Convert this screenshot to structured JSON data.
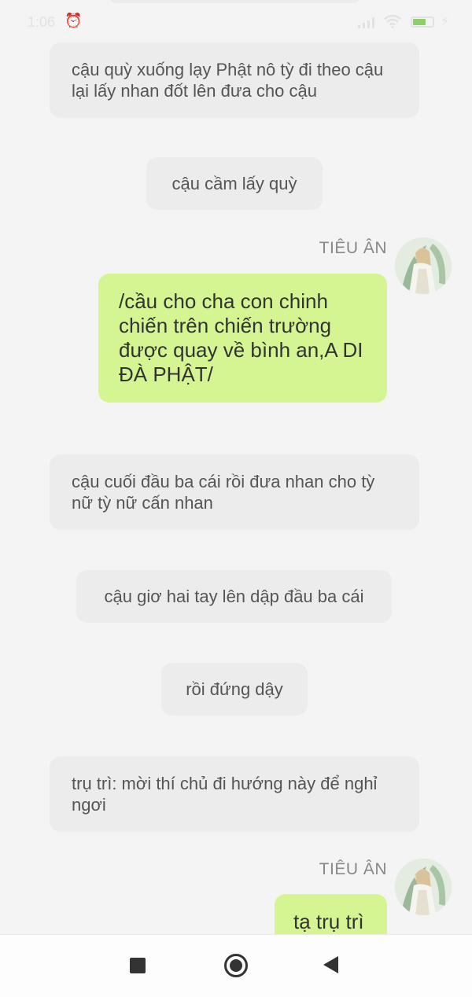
{
  "status_bar": {
    "time": "1:06",
    "battery": "65",
    "battery_percent": 65
  },
  "messages": [
    {
      "type": "narration",
      "text": "cậu quỳ xuống lạy Phật nô tỳ đi theo cậu lại lấy nhan đốt lên đưa cho cậu"
    },
    {
      "type": "narration",
      "text": "cậu cầm lấy quỳ"
    },
    {
      "type": "user",
      "sender": "TIÊU ÂN",
      "text": "/cầu cho cha con chinh chiến trên chiến trường được quay về bình an,A DI ĐÀ PHẬT/"
    },
    {
      "type": "narration",
      "text": "cậu cuối đầu ba cái rồi đưa nhan cho tỳ nữ tỳ nữ cấn nhan"
    },
    {
      "type": "narration",
      "text": "cậu giơ hai tay lên dập đầu ba cái"
    },
    {
      "type": "narration",
      "text": "rồi đứng dậy"
    },
    {
      "type": "narration",
      "text": "trụ trì: mời thí chủ đi hướng này để nghỉ ngơi"
    },
    {
      "type": "user",
      "sender": "TIÊU ÂN",
      "text": "tạ trụ trì"
    }
  ],
  "colors": {
    "background": "#f4f4f4",
    "narration_bubble": "#ececec",
    "user_bubble": "#d5f593"
  },
  "icons": {
    "nav_recent": "square-icon",
    "nav_home": "circle-home-icon",
    "nav_back": "triangle-back-icon"
  }
}
